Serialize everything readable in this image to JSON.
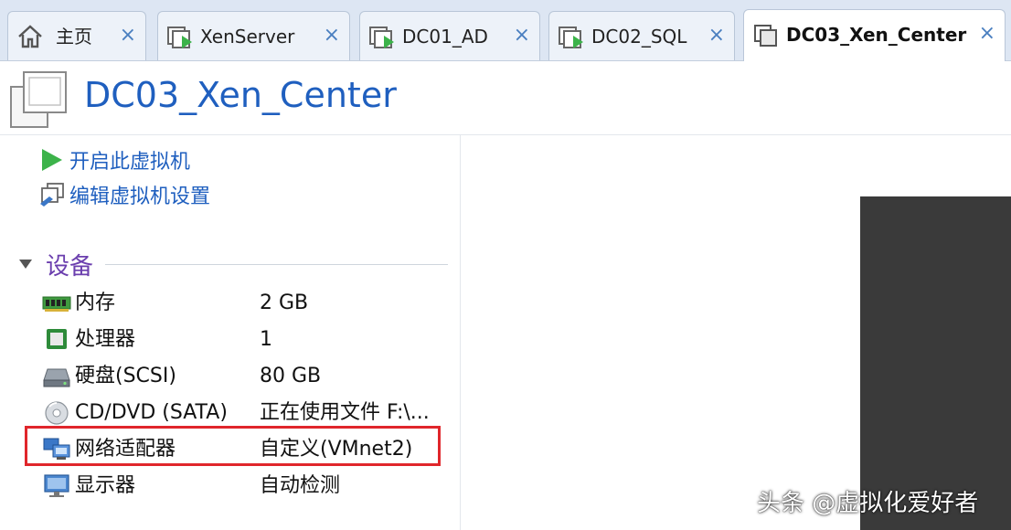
{
  "tabs": [
    {
      "label": "主页",
      "icon": "home-icon",
      "active": false
    },
    {
      "label": "XenServer",
      "icon": "vm-running-icon",
      "active": false
    },
    {
      "label": "DC01_AD",
      "icon": "vm-running-icon",
      "active": false
    },
    {
      "label": "DC02_SQL",
      "icon": "vm-running-icon",
      "active": false
    },
    {
      "label": "DC03_Xen_Center",
      "icon": "vm-icon",
      "active": true
    }
  ],
  "tab_close_glyph": "×",
  "vm": {
    "title": "DC03_Xen_Center",
    "icon": "vm-large-icon"
  },
  "actions": {
    "power_on": "开启此虚拟机",
    "edit_settings": "编辑虚拟机设置"
  },
  "devices_section": {
    "title": "设备"
  },
  "devices": [
    {
      "name": "内存",
      "value": "2 GB",
      "icon": "memory-icon"
    },
    {
      "name": "处理器",
      "value": "1",
      "icon": "cpu-icon"
    },
    {
      "name": "硬盘(SCSI)",
      "value": "80 GB",
      "icon": "hard-disk-icon"
    },
    {
      "name": "CD/DVD (SATA)",
      "value": "正在使用文件 F:\\...",
      "icon": "cd-dvd-icon"
    },
    {
      "name": "网络适配器",
      "value": "自定义(VMnet2)",
      "icon": "network-adapter-icon",
      "highlighted": true
    },
    {
      "name": "显示器",
      "value": "自动检测",
      "icon": "monitor-icon"
    }
  ],
  "colors": {
    "accent_blue": "#1f5fbf",
    "section_purple": "#6b3fae",
    "highlight_red": "#e0262b",
    "play_green": "#3cb34a"
  },
  "watermark": "头条 @虚拟化爱好者"
}
